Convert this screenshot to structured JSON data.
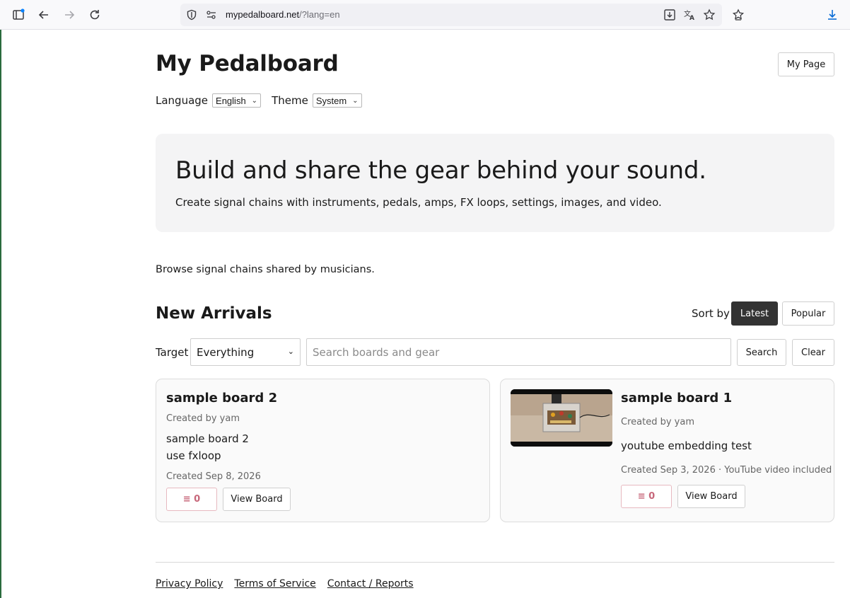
{
  "browser": {
    "url_host": "mypedalboard.net",
    "url_path": "/?lang=en"
  },
  "header": {
    "title": "My Pedalboard",
    "my_page_label": "My Page",
    "language_label": "Language",
    "language_value": "English",
    "theme_label": "Theme",
    "theme_value": "System"
  },
  "hero": {
    "headline": "Build and share the gear behind your sound.",
    "subtext": "Create signal chains with instruments, pedals, amps, FX loops, settings, images, and video."
  },
  "browse_text": "Browse signal chains shared by musicians.",
  "arrivals": {
    "title": "New Arrivals",
    "sort_label": "Sort by",
    "sort_options": [
      "Latest",
      "Popular"
    ],
    "active_sort": "Latest"
  },
  "filters": {
    "target_label": "Target",
    "target_value": "Everything",
    "search_placeholder": "Search boards and gear",
    "search_label": "Search",
    "clear_label": "Clear"
  },
  "cards": [
    {
      "title": "sample board 2",
      "author": "Created by yam",
      "description_lines": [
        "sample board 2",
        "use fxloop"
      ],
      "created": "Created Sep 8, 2026",
      "likes": "≡ 0",
      "view_label": "View Board"
    },
    {
      "title": "sample board 1",
      "author": "Created by yam",
      "description_lines": [
        "youtube embedding test"
      ],
      "created": "Created Sep 3, 2026 · YouTube video included",
      "likes": "≡ 0",
      "view_label": "View Board"
    }
  ],
  "footer": {
    "links": [
      "Privacy Policy",
      "Terms of Service",
      "Contact / Reports"
    ]
  },
  "colors": {
    "accent_dark": "#333333",
    "like_pink": "#c7677a",
    "hero_bg": "#f4f4f5"
  }
}
